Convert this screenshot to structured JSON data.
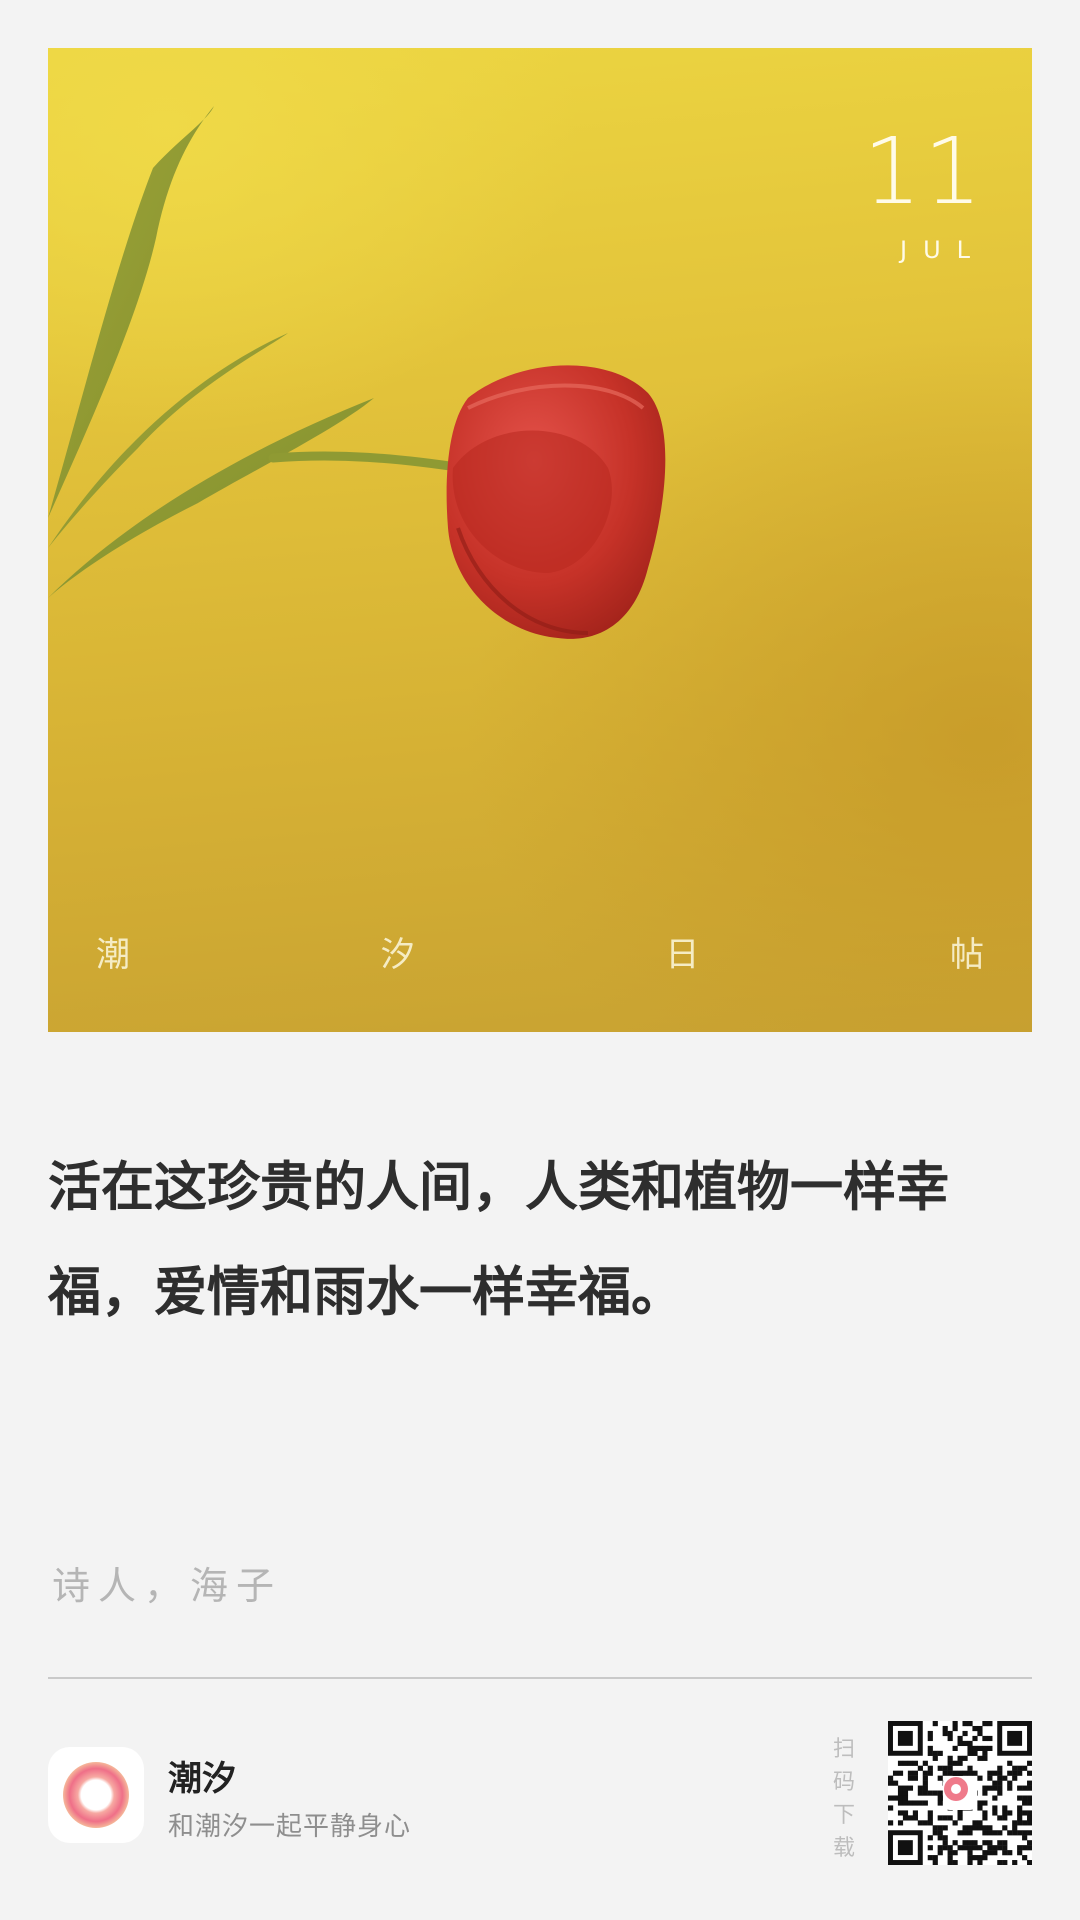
{
  "card": {
    "date_day": "11",
    "date_month": "JUL",
    "caption_chars": [
      "潮",
      "汐",
      "日",
      "帖"
    ]
  },
  "quote": {
    "text": "活在这珍贵的人间，人类和植物一样幸福，爱情和雨水一样幸福。",
    "author": "诗人，海子"
  },
  "footer": {
    "app_name": "潮汐",
    "slogan": "和潮汐一起平静身心",
    "scan_hint_chars": [
      "扫",
      "码",
      "下",
      "载"
    ],
    "logo_icon": "tide-ring-icon",
    "qr_icon": "qr-code-icon"
  },
  "colors": {
    "background": "#f3f3f3",
    "photo_yellow": "#e2c23a",
    "tulip_red": "#c9322b",
    "logo_pink": "#ef7a8a"
  }
}
